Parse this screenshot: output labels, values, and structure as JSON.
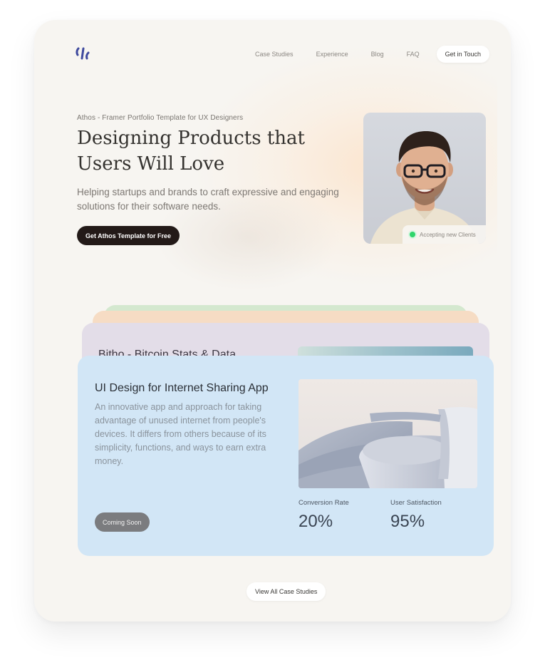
{
  "brand": {
    "logo_icon": "athos-logo-icon",
    "logo_color": "#3f4a9e"
  },
  "nav": {
    "links": [
      "Case Studies",
      "Experience",
      "Blog",
      "FAQ"
    ],
    "cta": "Get in Touch"
  },
  "hero": {
    "eyebrow": "Athos - Framer Portfolio Template for UX Designers",
    "headline_line1": "Designing Products that",
    "headline_line2": "Users Will Love",
    "subtext": "Helping startups and brands to craft expressive and engaging solutions for their software needs.",
    "button": "Get Athos Template for Free",
    "status": "Accepting new Clients",
    "status_color": "#2fd56b"
  },
  "case_studies": {
    "stack_colors": [
      "#d4e8cf",
      "#f6dcc4",
      "#e3dde8",
      "#d2e6f6"
    ],
    "back_card_title": "Bitho - Bitcoin Stats & Data",
    "featured": {
      "title": "UI Design for Internet Sharing App",
      "description": "An innovative app and approach for taking advantage of unused internet from people's devices. It differs from others because of its simplicity, functions, and ways to earn extra money.",
      "button": "Coming Soon",
      "metrics": [
        {
          "label": "Conversion Rate",
          "value": "20%"
        },
        {
          "label": "User Satisfaction",
          "value": "95%"
        }
      ]
    },
    "view_all": "View All Case Studies"
  }
}
